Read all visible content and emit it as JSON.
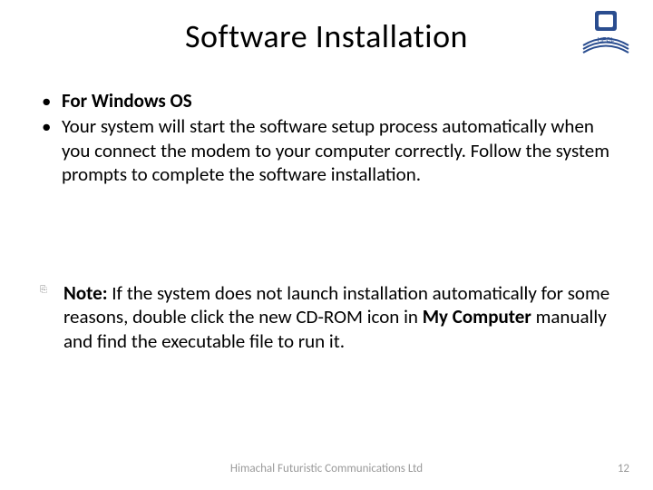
{
  "title": "Software Installation",
  "bullets": {
    "b1": "For Windows OS",
    "b2": "Your system will start the software setup process automatically when you connect the modem to your computer correctly. Follow the system prompts to complete the software installation."
  },
  "note": {
    "label": "Note:",
    "pre": " If the system does not launch installation automatically for some reasons, double click the new CD-ROM icon in ",
    "mycomputer": "My Computer",
    "post": " manually and find the executable file to run it."
  },
  "footer": "Himachal Futuristic Communications Ltd",
  "page_number": "12",
  "logo_label": "HFCL"
}
